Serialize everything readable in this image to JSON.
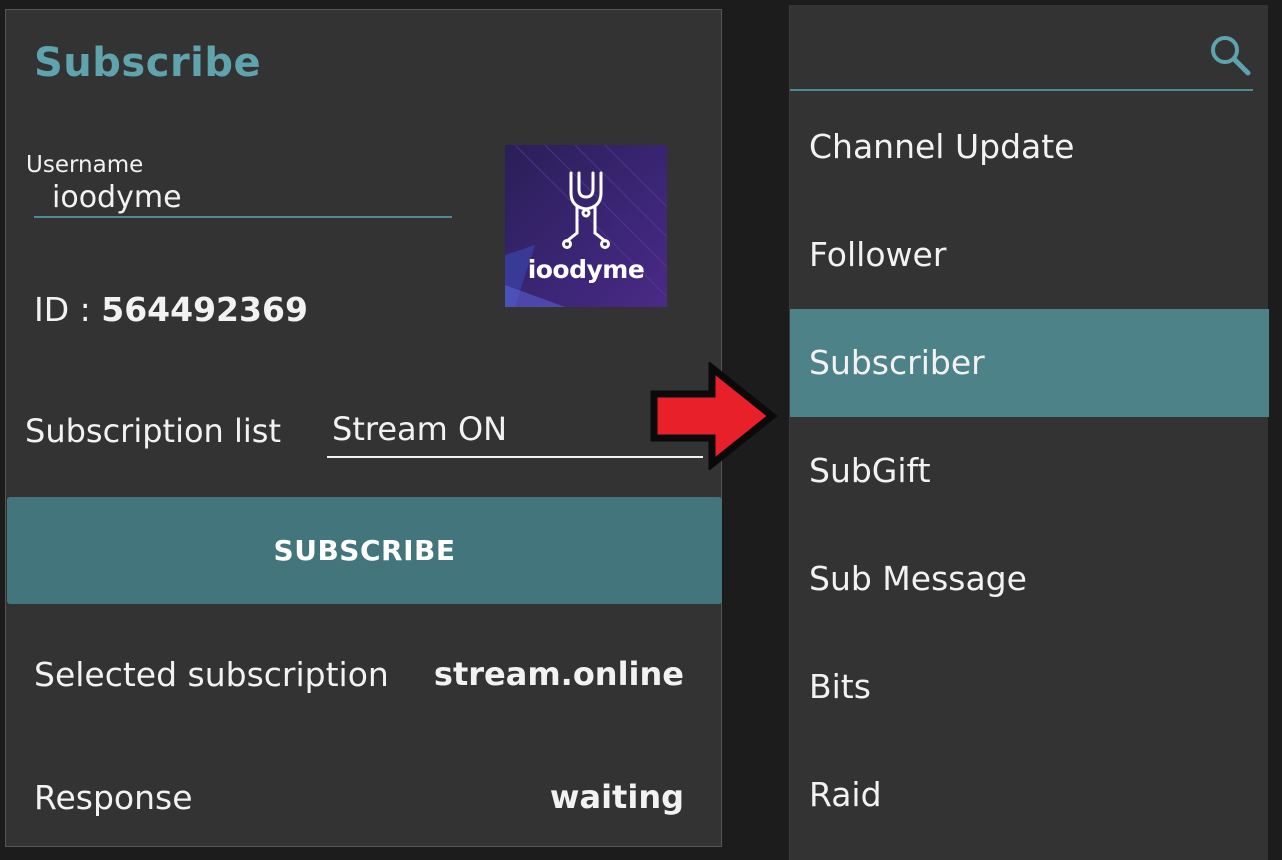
{
  "panel": {
    "title": "Subscribe",
    "username_label": "Username",
    "username_value": "ioodyme",
    "avatar_brand_text": "ioodyme",
    "id_label": "ID : ",
    "id_value": "564492369",
    "subscription_list_label": "Subscription list",
    "subscription_list_value": "Stream ON",
    "subscribe_button": "SUBSCRIBE",
    "selected_subscription_label": "Selected subscription",
    "selected_subscription_value": "stream.online",
    "response_label": "Response",
    "response_value": "waiting"
  },
  "dropdown": {
    "search_placeholder": "",
    "selected_index": 2,
    "items": [
      {
        "label": "Channel Update"
      },
      {
        "label": "Follower"
      },
      {
        "label": "Subscriber"
      },
      {
        "label": "SubGift"
      },
      {
        "label": "Sub Message"
      },
      {
        "label": "Bits"
      },
      {
        "label": "Raid"
      }
    ]
  },
  "colors": {
    "accent": "#5fa3ad",
    "button": "#43767c",
    "selected_item": "#4e8289",
    "panel_bg": "#333333",
    "arrow": "#e8202a"
  },
  "icons": {
    "search": "search-icon",
    "arrow": "arrow-right-icon",
    "logo": "wrench-circuit-logo-icon"
  }
}
